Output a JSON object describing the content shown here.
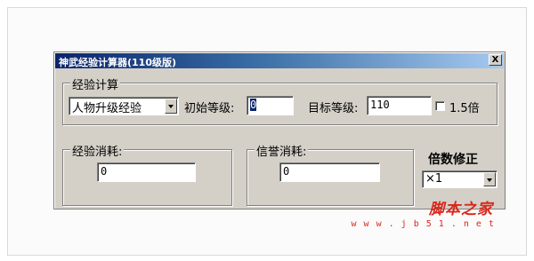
{
  "window": {
    "title": "神武经验计算器(110级版)",
    "close_label": "X"
  },
  "exp_calc": {
    "legend": "经验计算",
    "category_value": "人物升级经验",
    "initial_level_label": "初始等级:",
    "initial_level_value": "0",
    "target_level_label": "目标等级:",
    "target_level_value": "110",
    "multiplier_label": "1.5倍",
    "multiplier_checked": false
  },
  "exp_cost": {
    "legend": "经验消耗:",
    "value": "0"
  },
  "honor_cost": {
    "legend": "信誉消耗:",
    "value": "0"
  },
  "multiplier": {
    "label": "倍数修正",
    "value": "×1"
  },
  "watermark": {
    "text": "脚本之家",
    "url": "w w w . j b 5 1 . n e t"
  },
  "colors": {
    "face": "#d4d0c8",
    "title_start": "#0a246a",
    "title_end": "#a6caf0",
    "watermark": "#d9271c"
  }
}
